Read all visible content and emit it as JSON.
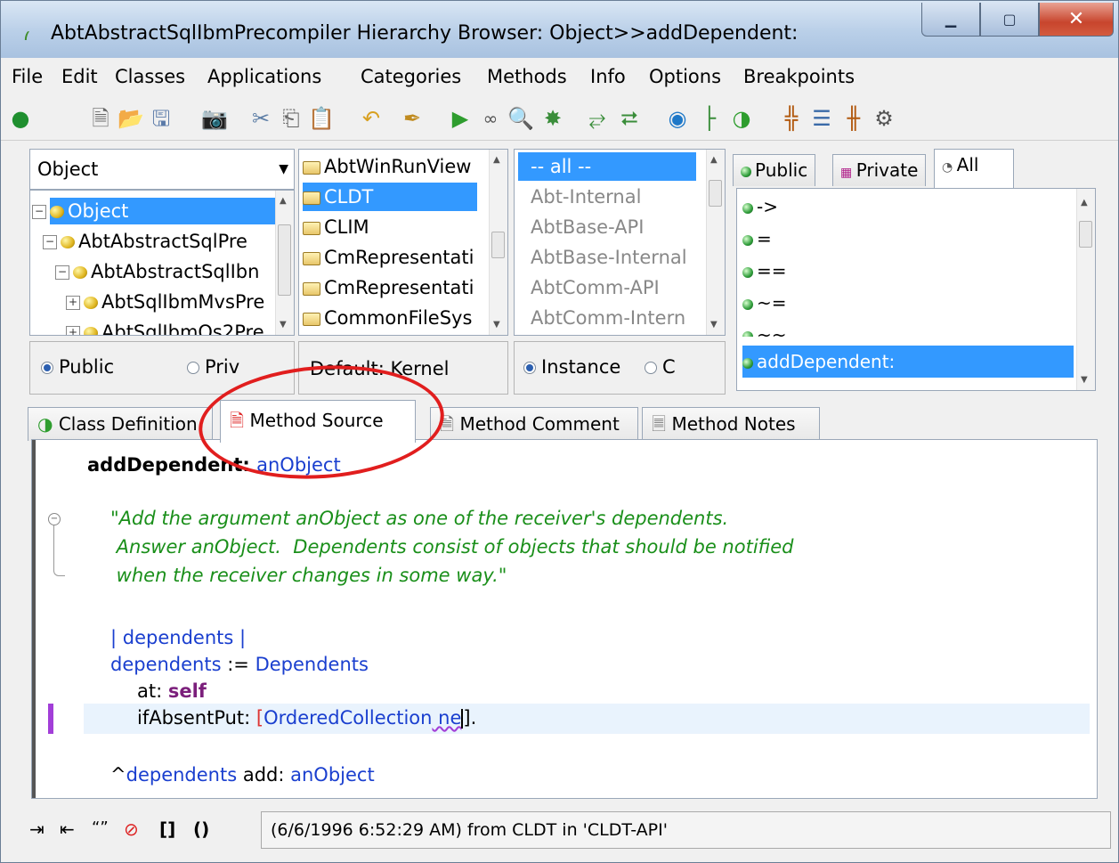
{
  "window": {
    "title": "AbtAbstractSqlIbmPrecompiler Hierarchy Browser: Object>>addDependent:"
  },
  "menu": [
    "File",
    "Edit",
    "Classes",
    "Applications",
    "Categories",
    "Methods",
    "Info",
    "Options",
    "Breakpoints"
  ],
  "toolbar_icons": [
    "run-icon",
    "new-icon",
    "open-icon",
    "save-icon",
    "camera-icon",
    "cut-icon",
    "copy-icon",
    "paste-icon",
    "undo-icon",
    "pin-icon",
    "play-icon",
    "glasses-icon",
    "magnify-icon",
    "bug-icon",
    "step-icon",
    "hierarchy-icon",
    "globe-icon",
    "tree-icon",
    "circle-arrow-icon",
    "grid-icon",
    "list-icon",
    "table-icon",
    "settings-icon"
  ],
  "class_pane": {
    "combo_value": "Object",
    "tree": [
      "Object",
      "AbtAbstractSqlPre",
      "AbtAbstractSqlIbn",
      "AbtSqlIbmMvsPre",
      "AbtSqlIbmOs2Pre"
    ],
    "radio_public": "Public",
    "radio_private": "Priv"
  },
  "apps_pane": {
    "items": [
      "AbtWinRunView",
      "CLDT",
      "CLIM",
      "CmRepresentati",
      "CmRepresentati",
      "CommonFileSys"
    ],
    "default_label": "Default: Kernel"
  },
  "categories_pane": {
    "items": [
      "-- all --",
      "Abt-Internal",
      "AbtBase-API",
      "AbtBase-Internal",
      "AbtComm-API",
      "AbtComm-Intern"
    ],
    "radio_instance": "Instance",
    "radio_class": "C"
  },
  "methods_pane": {
    "tabs": [
      "Public",
      "Private",
      "All"
    ],
    "items": [
      "->",
      "=",
      "==",
      "~=",
      "~~",
      "addDependent:"
    ]
  },
  "bottom_tabs": [
    "Class Definition",
    "Method Source",
    "Method Comment",
    "Method Notes"
  ],
  "source": {
    "selector": "addDependent:",
    "arg": "anObject",
    "comment1": "\"Add the argument anObject as one of the receiver's dependents.",
    "comment2": " Answer anObject.  Dependents consist of objects that should be notified",
    "comment3": " when the receiver changes in some way.\"",
    "temps_open": "| ",
    "temps_var": "dependents",
    "temps_close": " |",
    "assign_var": "dependents",
    "assign_op": " := ",
    "assign_target": "Dependents",
    "at_label": "at: ",
    "at_value": "self",
    "ifabsent_label": "ifAbsentPut: ",
    "bracket_open": "[",
    "collection": "OrderedCollection",
    "new_partial": " ne",
    "line_end": "].",
    "return_caret": "^",
    "return_var": "dependents",
    "return_msg": " add: ",
    "return_arg": "anObject"
  },
  "status": {
    "icons": [
      "indent-icon",
      "outdent-icon",
      "quote-icon",
      "no-comment-icon",
      "brackets-icon",
      "parens-icon"
    ],
    "text": "(6/6/1996 6:52:29 AM) from CLDT in 'CLDT-API'"
  }
}
